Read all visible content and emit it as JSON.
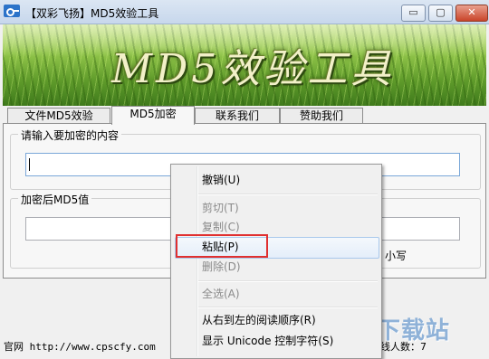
{
  "window": {
    "title": "【双彩飞扬】MD5效验工具",
    "minimize_symbol": "▭",
    "maximize_symbol": "▢",
    "close_symbol": "✕"
  },
  "banner": {
    "title": "MD5效验工具"
  },
  "tabs": [
    {
      "label": "文件MD5效验",
      "active": false
    },
    {
      "label": "MD5加密",
      "active": true
    },
    {
      "label": "联系我们",
      "active": false
    },
    {
      "label": "赞助我们",
      "active": false
    }
  ],
  "input_group": {
    "label": "请输入要加密的内容",
    "value": ""
  },
  "output_group": {
    "label": "加密后MD5值",
    "value": ""
  },
  "case_option": {
    "label": "小写"
  },
  "context_menu": {
    "items": [
      {
        "label": "撤销(U)",
        "enabled": true
      },
      {
        "label": "剪切(T)",
        "enabled": false
      },
      {
        "label": "复制(C)",
        "enabled": false
      },
      {
        "label": "粘贴(P)",
        "enabled": true,
        "highlighted": true
      },
      {
        "label": "删除(D)",
        "enabled": false
      },
      {
        "label": "全选(A)",
        "enabled": false
      },
      {
        "label": "从右到左的阅读顺序(R)",
        "enabled": true
      },
      {
        "label": "显示 Unicode 控制字符(S)",
        "enabled": true
      }
    ],
    "highlight_color": "#e03030"
  },
  "status_bar": {
    "website": "官网 http://www.cpscfy.com",
    "online": "线人数：7"
  },
  "watermark": {
    "text": "极速下载站"
  },
  "colors": {
    "accent_red": "#e03030",
    "watermark_blue": "#8fb2d8"
  }
}
